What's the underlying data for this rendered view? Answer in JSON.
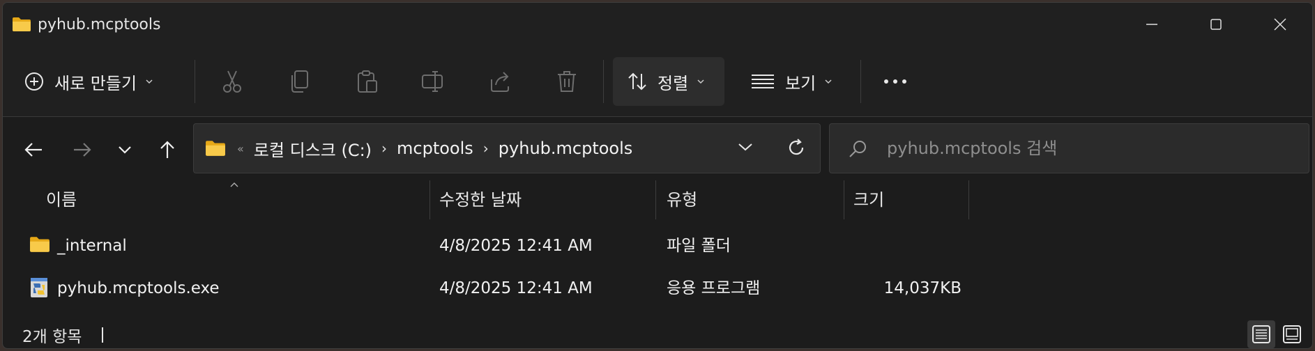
{
  "window": {
    "title": "pyhub.mcptools"
  },
  "toolbar": {
    "new_label": "새로 만들기",
    "sort_label": "정렬",
    "view_label": "보기",
    "icons": [
      "add-circle-icon",
      "cut-icon",
      "copy-icon",
      "paste-icon",
      "rename-icon",
      "share-icon",
      "delete-icon",
      "sort-icon",
      "view-lines-icon",
      "more-icon"
    ]
  },
  "address": {
    "overflow": "«",
    "crumbs": [
      "로컬 디스크 (C:)",
      "mcptools",
      "pyhub.mcptools"
    ],
    "separator": "›"
  },
  "search": {
    "placeholder": "pyhub.mcptools 검색"
  },
  "columns": {
    "name": "이름",
    "modified": "수정한 날짜",
    "type": "유형",
    "size": "크기"
  },
  "files": [
    {
      "name": "_internal",
      "modified": "4/8/2025 12:41 AM",
      "type": "파일 폴더",
      "size": "",
      "icon": "folder-icon"
    },
    {
      "name": "pyhub.mcptools.exe",
      "modified": "4/8/2025 12:41 AM",
      "type": "응용 프로그램",
      "size": "14,037KB",
      "icon": "python-exe-icon"
    }
  ],
  "status": {
    "item_count": "2개 항목"
  },
  "colors": {
    "window_bg": "#1c1c1c",
    "chrome_bg": "#202020",
    "folder_yellow": "#f5c542",
    "text": "#ffffff"
  }
}
